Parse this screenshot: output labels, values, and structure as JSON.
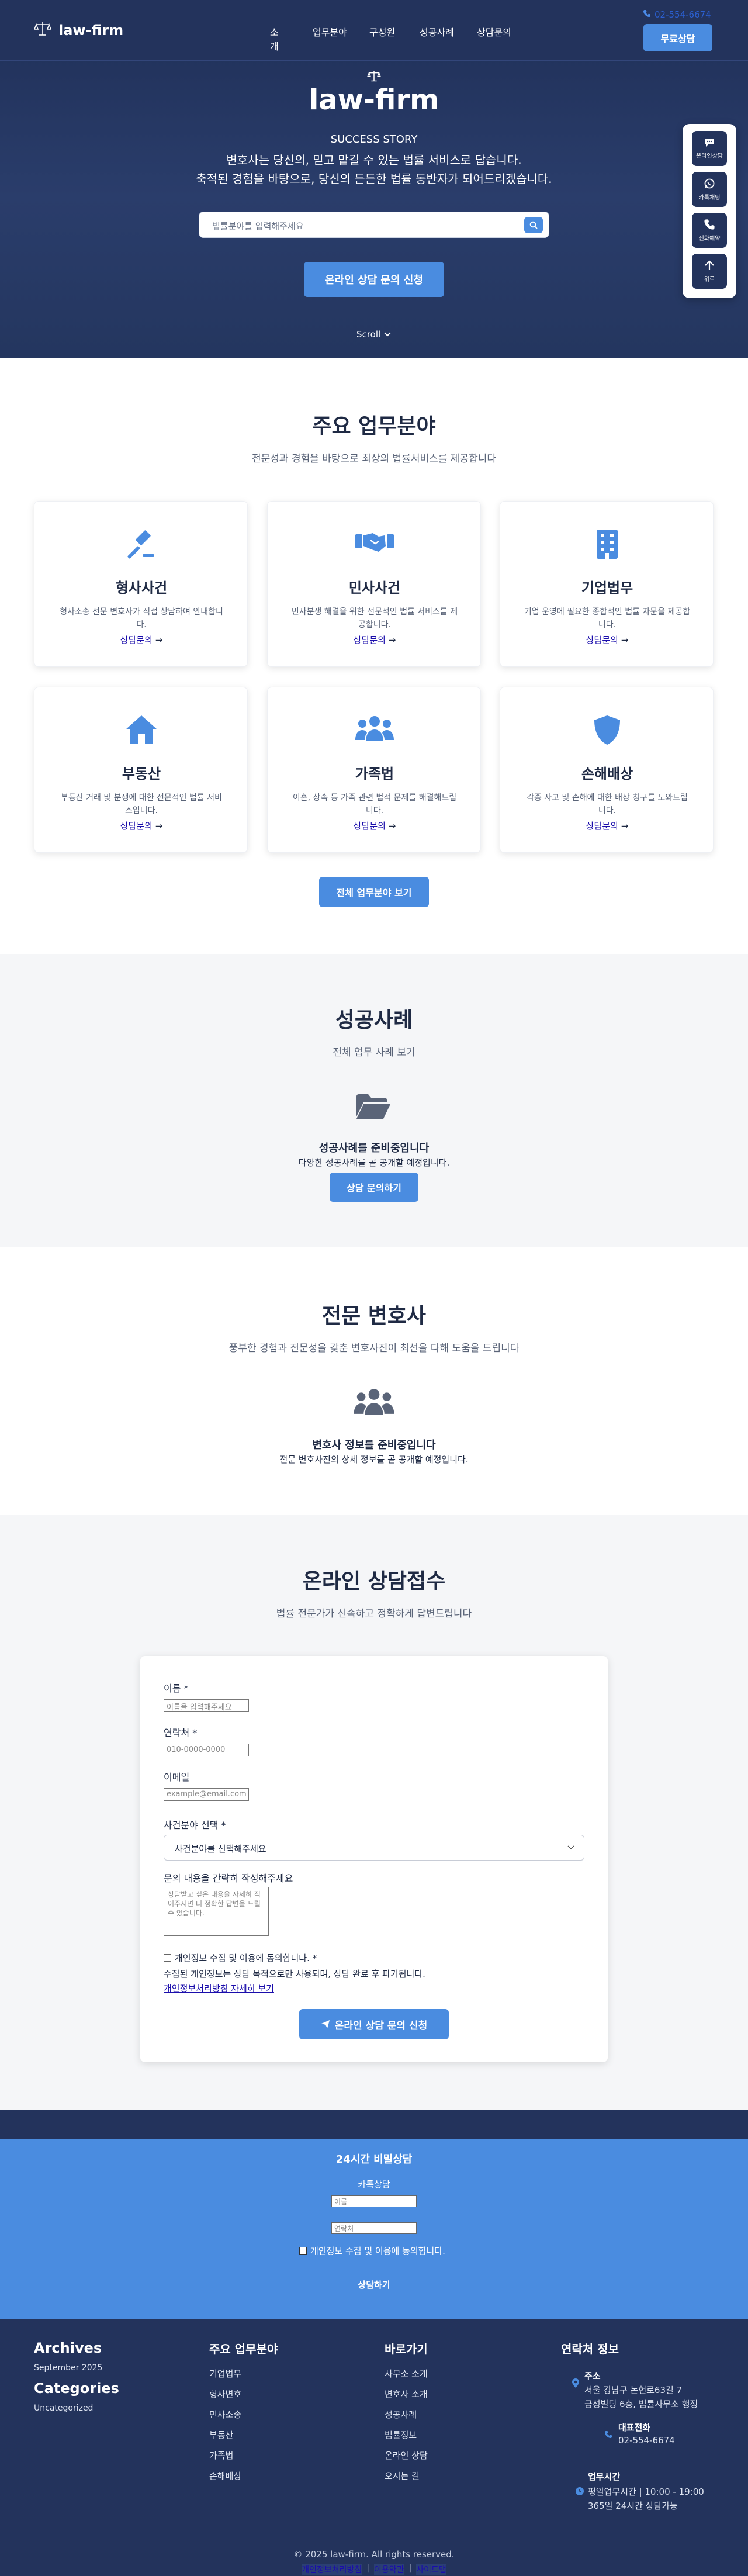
{
  "header": {
    "logo_text": "law-firm",
    "nav": [
      "소개",
      "업무분야",
      "구성원",
      "성공사례",
      "상담문의"
    ],
    "phone": "02-554-6674",
    "cta": "무료상담"
  },
  "hero": {
    "title": "law-firm",
    "subtitle": "SUCCESS STORY",
    "line1": "변호사는 당신의, 믿고 맡길 수 있는 법률 서비스로 답습니다.",
    "line2": "축적된 경험을 바탕으로, 당신의 든든한 법률 동반자가 되어드리겠습니다.",
    "search_placeholder": "법률분야를 입력해주세요",
    "cta": "온라인 상담 문의 신청",
    "scroll": "Scroll"
  },
  "quickbar": [
    {
      "label": "온라인상담",
      "icon": "chat-icon"
    },
    {
      "label": "카톡채팅",
      "icon": "whatsapp-icon"
    },
    {
      "label": "전화예약",
      "icon": "phone-icon"
    },
    {
      "label": "위로",
      "icon": "arrow-up-icon"
    }
  ],
  "practice": {
    "title": "주요 업무분야",
    "subtitle": "전문성과 경험을 바탕으로 최상의 법률서비스를 제공합니다",
    "cards": [
      {
        "title": "형사사건",
        "desc": "형사소송 전문 변호사가 직접 상담하여 안내합니다.",
        "link": "상담문의",
        "icon": "gavel-icon"
      },
      {
        "title": "민사사건",
        "desc": "민사분쟁 해결을 위한 전문적인 법률 서비스를 제공합니다.",
        "link": "상담문의",
        "icon": "handshake-icon"
      },
      {
        "title": "기업법무",
        "desc": "기업 운영에 필요한 종합적인 법률 자문을 제공합니다.",
        "link": "상담문의",
        "icon": "building-icon"
      },
      {
        "title": "부동산",
        "desc": "부동산 거래 및 분쟁에 대한 전문적인 법률 서비스입니다.",
        "link": "상담문의",
        "icon": "home-icon"
      },
      {
        "title": "가족법",
        "desc": "이혼, 상속 등 가족 관련 법적 문제를 해결해드립니다.",
        "link": "상담문의",
        "icon": "users-icon"
      },
      {
        "title": "손해배상",
        "desc": "각종 사고 및 손해에 대한 배상 청구를 도와드립니다.",
        "link": "상담문의",
        "icon": "shield-icon"
      }
    ],
    "all_button": "전체 업무분야 보기"
  },
  "cases": {
    "title": "성공사례",
    "subtitle": "전체 업무 사례 보기",
    "empty_title": "성공사례를 준비중입니다",
    "empty_desc": "다양한 성공사례를 곧 공개할 예정입니다.",
    "button": "상담 문의하기"
  },
  "lawyers": {
    "title": "전문 변호사",
    "subtitle": "풍부한 경험과 전문성을 갖춘 변호사진이 최선을 다해 도움을 드립니다",
    "empty_title": "변호사 정보를 준비중입니다",
    "empty_desc": "전문 변호사진의 상세 정보를 곧 공개할 예정입니다."
  },
  "consult": {
    "title": "온라인 상담접수",
    "subtitle": "법률 전문가가 신속하고 정확하게 답변드립니다",
    "name_label": "이름 *",
    "name_placeholder": "이름을 입력해주세요",
    "phone_label": "연락처 *",
    "phone_placeholder": "010-0000-0000",
    "email_label": "이메일",
    "email_placeholder": "example@email.com",
    "field_label": "사건분야 선택 *",
    "field_value": "사건분야를 선택해주세요",
    "content_label": "문의 내용을 간략히 작성해주세요",
    "content_placeholder": "상담받고 싶은 내용을 자세히 적어주시면 더 정확한 답변을 드릴 수 있습니다.",
    "agree_label": "개인정보 수집 및 이용에 동의합니다. *",
    "agree_note": "수집된 개인정보는 상담 목적으로만 사용되며, 상담 완료 후 파기됩니다.",
    "privacy_link": "개인정보처리방침 자세히 보기",
    "submit": "온라인 상담 문의 신청"
  },
  "band": {
    "title": "24시간 비밀상담",
    "sub": "카톡상담",
    "name_placeholder": "이름",
    "phone_placeholder": "연락처",
    "agree": "개인정보 수집 및 이용에 동의합니다.",
    "submit": "상담하기"
  },
  "footer": {
    "archives_title": "Archives",
    "archives_item": "September 2025",
    "categories_title": "Categories",
    "categories_item": "Uncategorized",
    "col1_title": "주요 업무분야",
    "col1_items": [
      "기업법무",
      "형사변호",
      "민사소송",
      "부동산",
      "가족법",
      "손해배상"
    ],
    "col2_title": "바로가기",
    "col2_items": [
      "사무소 소개",
      "변호사 소개",
      "성공사례",
      "법률정보",
      "온라인 상담",
      "오시는 길"
    ],
    "col3_title": "연락처 정보",
    "address_label": "주소",
    "address_line1": "서울 강남구 논현로63길 7",
    "address_line2": "금성빌딩 6층, 법률사무소 행정",
    "phone_label": "대표전화",
    "phone_value": "02-554-6674",
    "hours_label": "업무시간",
    "hours_line1": "평일업무시간 | 10:00 - 19:00",
    "hours_line2": "365일 24시간 상담가능",
    "copyright": "© 2025 law-firm. All rights reserved.",
    "bottom_links": [
      "개인정보처리방침",
      "이용약관",
      "사이트맵"
    ]
  },
  "colors": {
    "navy": "#23335c",
    "accent": "#4a8ce0",
    "gray_bg": "#f5f6f8"
  }
}
